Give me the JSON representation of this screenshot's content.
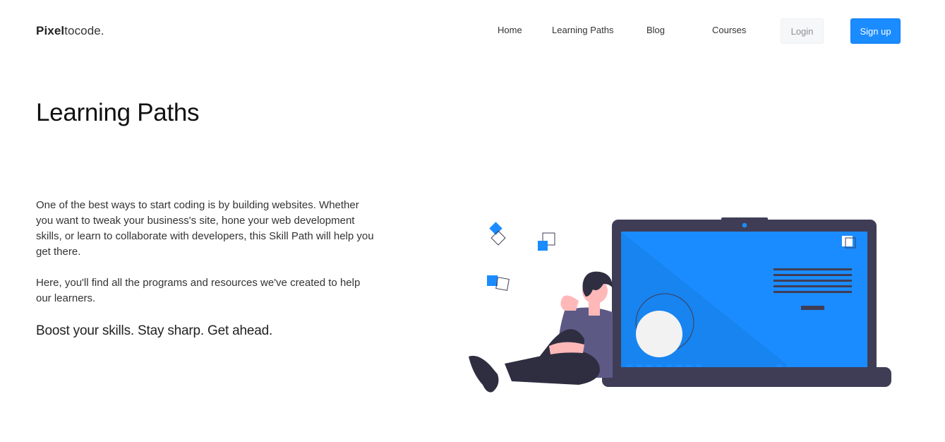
{
  "header": {
    "logo_bold": "Pixel",
    "logo_light": "tocode."
  },
  "nav": {
    "items": [
      {
        "label": "Home"
      },
      {
        "label": "Learning Paths"
      },
      {
        "label": "Blog"
      },
      {
        "label": "Courses"
      }
    ],
    "login_label": "Login",
    "signup_label": "Sign up"
  },
  "main": {
    "title": "Learning Paths",
    "paragraphs": [
      "One of the best ways to start coding is by building websites. Whether you want to tweak your business's site, hone your web development skills, or learn to collaborate with developers, this Skill Path will help you get there.",
      "Here, you'll find all the programs and resources we've created to help our learners."
    ],
    "tagline": "Boost your skills. Stay sharp. Get ahead."
  },
  "colors": {
    "accent": "#1a8cff",
    "laptop_frame": "#3f3d56",
    "text": "#222222"
  }
}
